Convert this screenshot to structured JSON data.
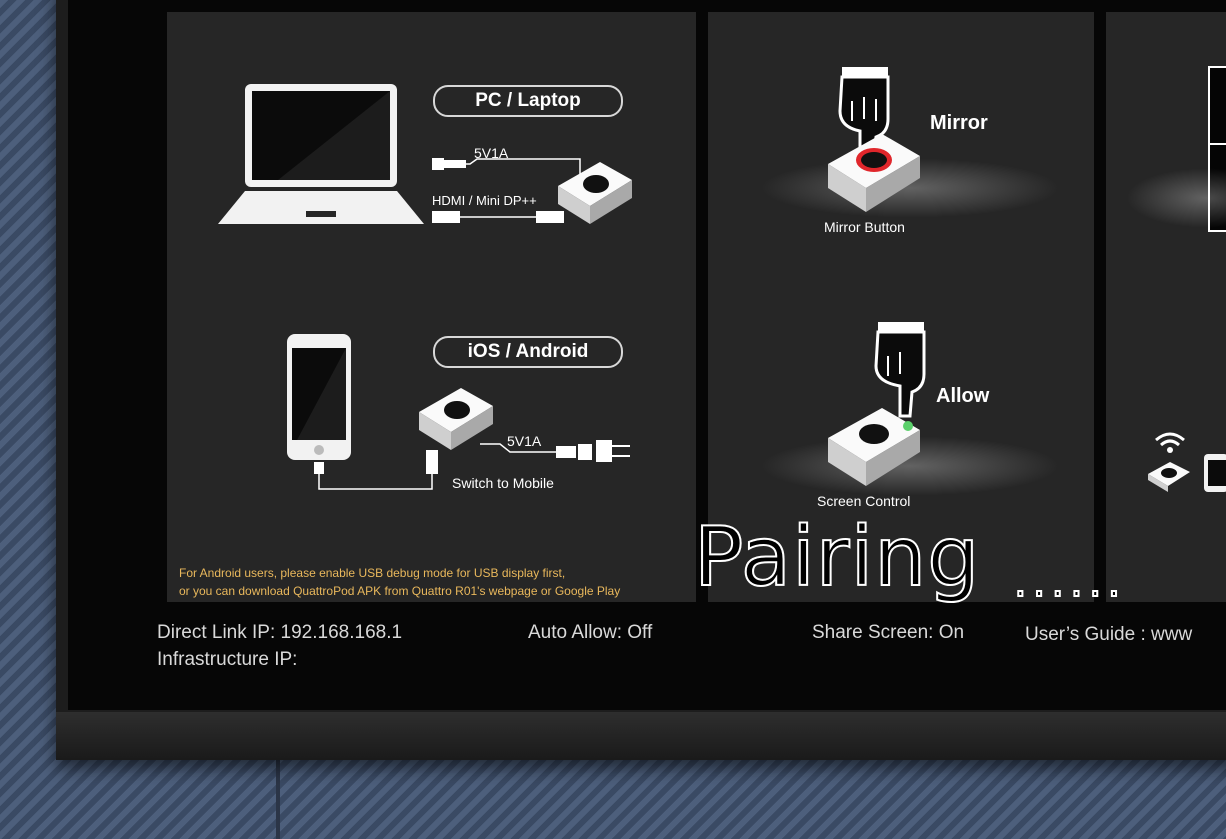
{
  "panel1": {
    "pc_label": "PC / Laptop",
    "pc_power_label": "5V1A",
    "pc_video_label": "HDMI / Mini DP++",
    "mobile_label": "iOS / Android",
    "mobile_power_label": "5V1A",
    "switch_label": "Switch to Mobile",
    "note_line1": "For Android users, please enable USB debug mode for USB display first,",
    "note_line2": "or you can download QuattroPod APK from Quattro R01's webpage or Google Play"
  },
  "panel2": {
    "mirror_label": "Mirror",
    "mirror_button_label": "Mirror Button",
    "allow_label": "Allow",
    "screen_control_label": "Screen Control"
  },
  "overlay": {
    "pairing_text": "Pairing",
    "pairing_dots": "......"
  },
  "status_bar": {
    "direct_link_ip": "Direct Link IP: 192.168.168.1",
    "infrastructure_ip": "Infrastructure IP:",
    "auto_allow": "Auto Allow: Off",
    "share_screen": "Share Screen: On",
    "users_guide": "User’s Guide : www"
  },
  "colors": {
    "note_color": "#e9b85c",
    "mirror_ring": "#e0262b",
    "allow_led": "#5bd06b"
  }
}
